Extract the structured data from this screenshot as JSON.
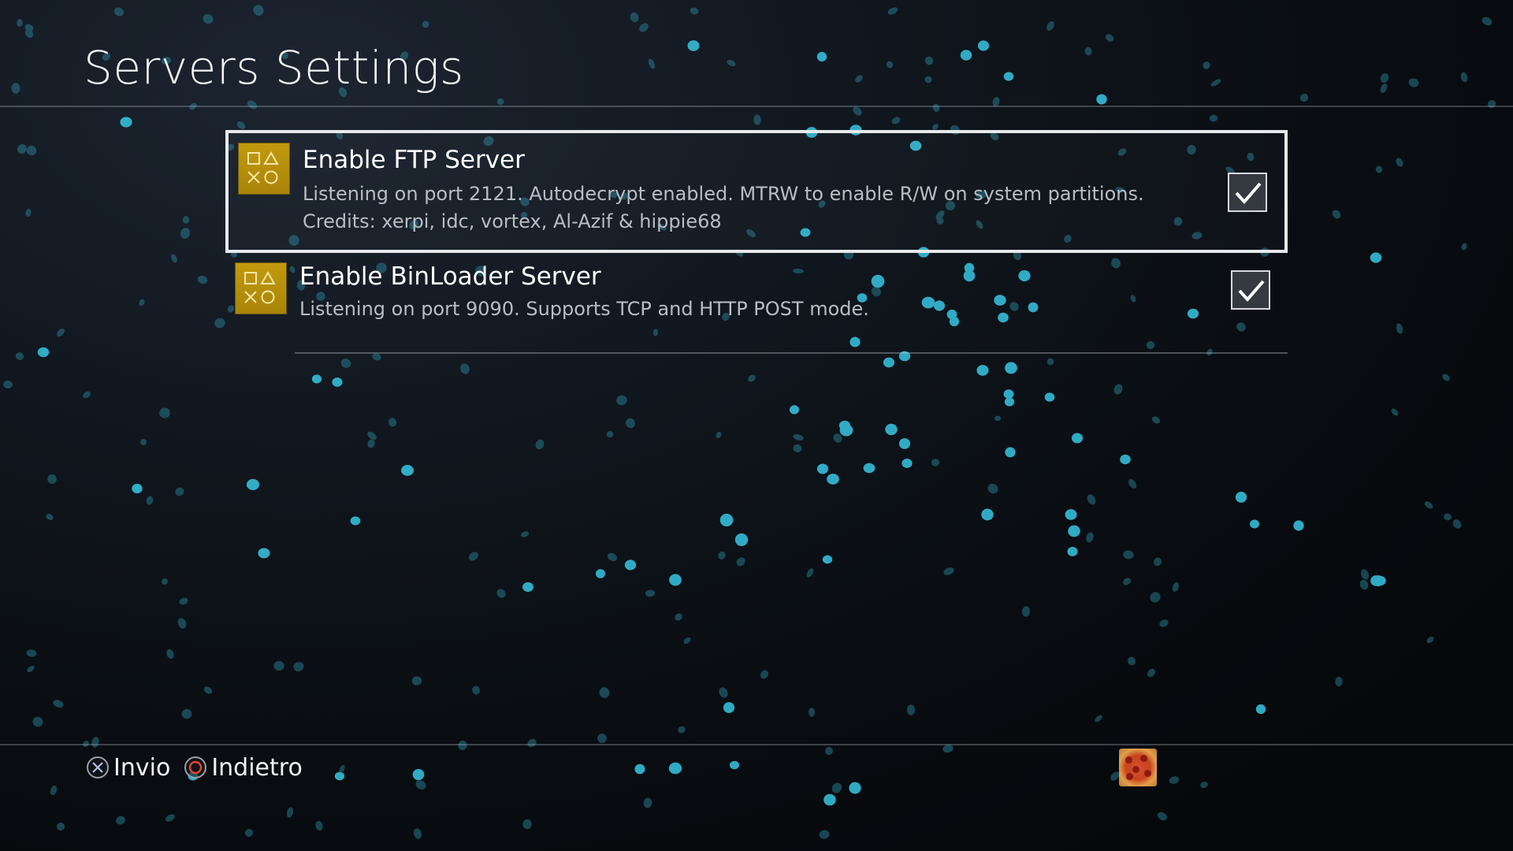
{
  "page": {
    "title": "Servers Settings"
  },
  "settings": {
    "items": [
      {
        "title": "Enable FTP Server",
        "desc_line1": "Listening on port 2121. Autodecrypt enabled. MTRW to enable R/W on system partitions.",
        "desc_line2": "Credits: xerpi, idc, vortex, Al-Azif & hippie68",
        "checked": true,
        "selected": true,
        "icon": "playstation-shapes-icon"
      },
      {
        "title": "Enable BinLoader Server",
        "desc_line1": "Listening on port 9090. Supports TCP and HTTP POST mode.",
        "checked": true,
        "selected": false,
        "icon": "playstation-shapes-icon"
      }
    ]
  },
  "footer": {
    "confirm_label": "Invio",
    "confirm_icon": "cross-button-icon",
    "back_label": "Indietro",
    "back_icon": "circle-button-icon",
    "avatar_icon": "pizza-avatar-icon"
  },
  "colors": {
    "accent_icon": "#c29a0e",
    "particle": "#2fb6d3",
    "circle_button": "#e2462f"
  }
}
